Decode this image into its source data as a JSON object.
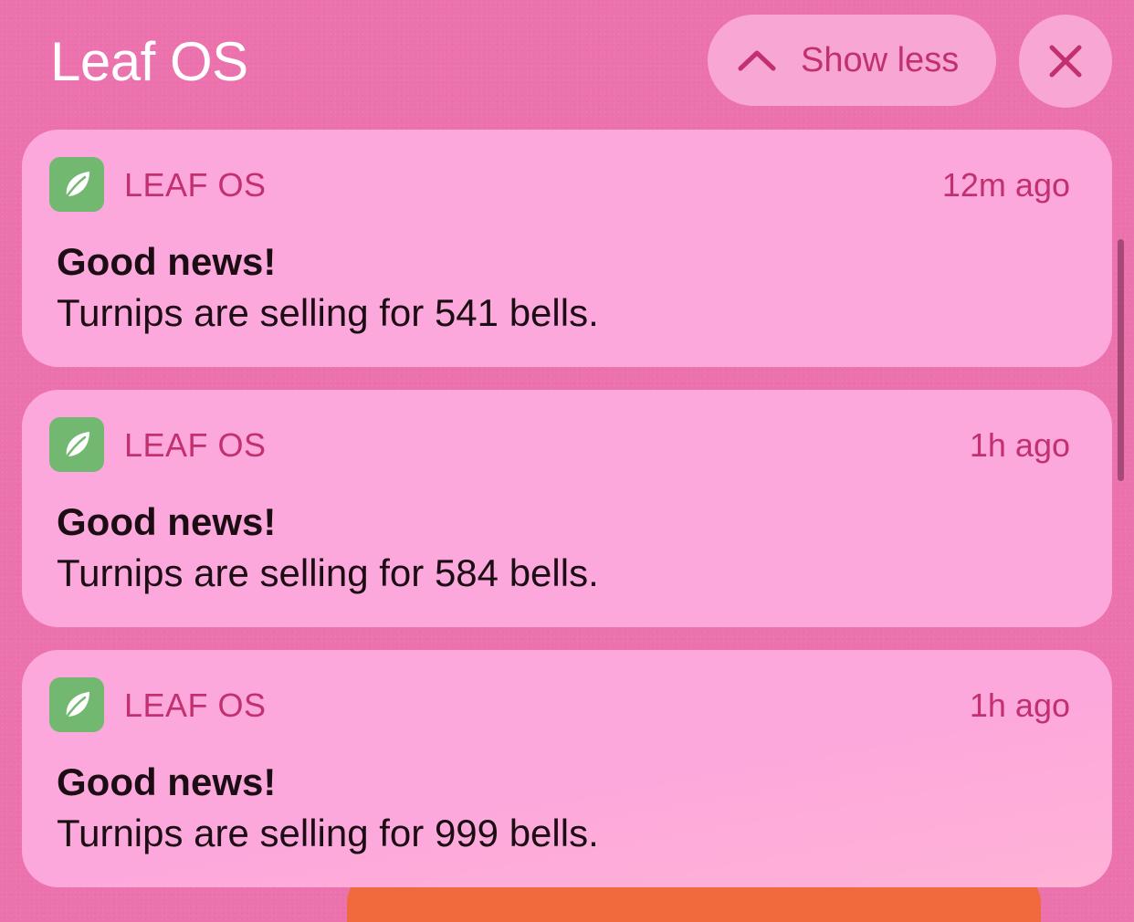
{
  "header": {
    "title": "Leaf OS",
    "show_less_label": "Show less"
  },
  "colors": {
    "background": "#ec72ad",
    "card": "#fda8dc",
    "accent_text": "#c3306f",
    "app_icon": "#73b871"
  },
  "notifications": [
    {
      "app_name": "LEAF OS",
      "app_icon": "leaf-icon",
      "time": "12m ago",
      "title": "Good news!",
      "body": "Turnips are selling for 541 bells."
    },
    {
      "app_name": "LEAF OS",
      "app_icon": "leaf-icon",
      "time": "1h ago",
      "title": "Good news!",
      "body": "Turnips are selling for 584 bells."
    },
    {
      "app_name": "LEAF OS",
      "app_icon": "leaf-icon",
      "time": "1h ago",
      "title": "Good news!",
      "body": "Turnips are selling for 999 bells."
    }
  ]
}
